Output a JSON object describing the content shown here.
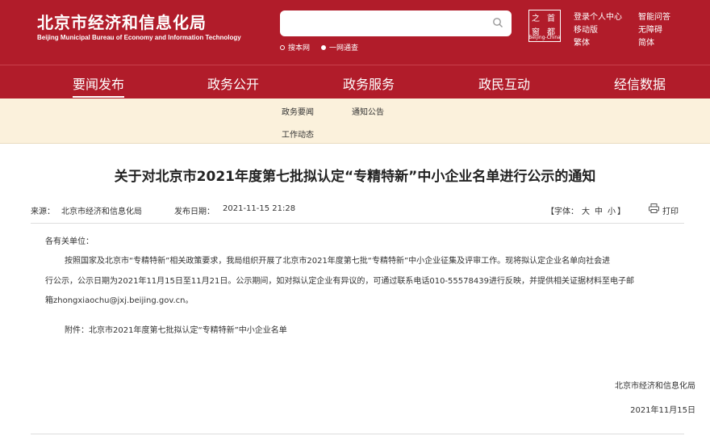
{
  "header": {
    "title": "北京市经济和信息化局",
    "subtitle": "Beijing Municipal Bureau of Economy and Information Technology",
    "search": {
      "value": "",
      "placeholder": ""
    },
    "scope_options": [
      "搜本网",
      "一网通查"
    ],
    "emblem_chars": [
      "之",
      "首",
      "窗",
      "都"
    ],
    "emblem_caption": "Beijing-China",
    "util_links": [
      "登录个人中心",
      "智能问答",
      "移动版",
      "无障碍",
      "繁体",
      "简体"
    ],
    "colors": {
      "brand_red": "#b11c2a",
      "subnav_bg": "#fbf1dc"
    }
  },
  "nav": {
    "items": [
      "要闻发布",
      "政务公开",
      "政务服务",
      "政民互动",
      "经信数据"
    ],
    "active_index": 0
  },
  "subnav": {
    "items": [
      "政务要闻",
      "通知公告",
      "工作动态"
    ]
  },
  "article": {
    "title": "关于对北京市2021年度第七批拟认定“专精特新”中小企业名单进行公示的通知",
    "source_label": "来源：",
    "source": "北京市经济和信息化局",
    "date_label": "发布日期：",
    "date": "2021-11-15 21:28",
    "font_label": "【字体：",
    "font_sizes": [
      "大",
      "中",
      "小"
    ],
    "font_close": "】",
    "print_label": "打印",
    "salutation": "各有关单位：",
    "paragraph_lines": [
      "按照国家及北京市“专精特新”相关政策要求，我局组织开展了北京市2021年度第七批“专精特新”中小企业征集及评审工作。现将拟认定企业名单向社会进",
      "行公示，公示日期为2021年11月15日至11月21日。公示期间，如对拟认定企业有异议的，可通过联系电话010-55578439进行反映，并提供相关证据材料至电子邮",
      "箱zhongxiaochu@jxj.beijing.gov.cn。"
    ],
    "attachment": "附件：北京市2021年度第七批拟认定“专精特新”中小企业名单",
    "signature": "北京市经济和信息化局",
    "sign_date": "2021年11月15日"
  }
}
